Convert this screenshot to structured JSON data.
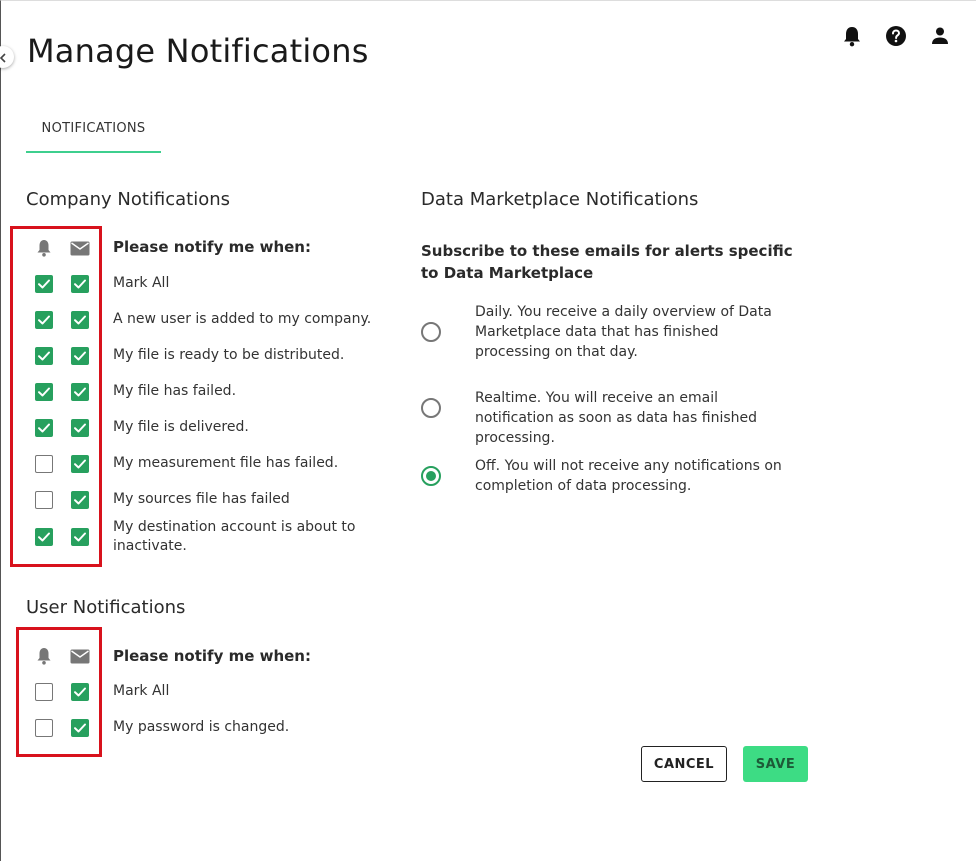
{
  "page": {
    "title": "Manage Notifications"
  },
  "tabs": [
    {
      "label": "NOTIFICATIONS",
      "active": true
    }
  ],
  "colors": {
    "accent": "#3ecf8e",
    "checkbox": "#27a05e",
    "highlight": "#d8121c",
    "save": "#3ddc84"
  },
  "company": {
    "title": "Company Notifications",
    "header": "Please notify me when:",
    "items": [
      {
        "label": "Mark All",
        "bell": true,
        "email": true
      },
      {
        "label": "A new user is added to my company.",
        "bell": true,
        "email": true
      },
      {
        "label": "My file is ready to be distributed.",
        "bell": true,
        "email": true
      },
      {
        "label": "My file has failed.",
        "bell": true,
        "email": true
      },
      {
        "label": "My file is delivered.",
        "bell": true,
        "email": true
      },
      {
        "label": "My measurement file has failed.",
        "bell": false,
        "email": true
      },
      {
        "label": "My sources file has failed",
        "bell": false,
        "email": true
      },
      {
        "label": "My destination account is about to inactivate.",
        "bell": true,
        "email": true
      }
    ]
  },
  "user": {
    "title": "User Notifications",
    "header": "Please notify me when:",
    "items": [
      {
        "label": "Mark All",
        "bell": false,
        "email": true
      },
      {
        "label": "My password is changed.",
        "bell": false,
        "email": true
      }
    ]
  },
  "marketplace": {
    "title": "Data Marketplace Notifications",
    "subtitle": "Subscribe to these emails for alerts specific to Data Marketplace",
    "options": [
      {
        "label": "Daily. You receive a daily overview of Data Marketplace data that has finished processing on that day.",
        "selected": false
      },
      {
        "label": "Realtime. You will receive an email notification as soon as data has finished processing.",
        "selected": false
      },
      {
        "label": "Off. You will not receive any notifications on completion of data processing.",
        "selected": true
      }
    ]
  },
  "buttons": {
    "cancel": "CANCEL",
    "save": "SAVE"
  }
}
